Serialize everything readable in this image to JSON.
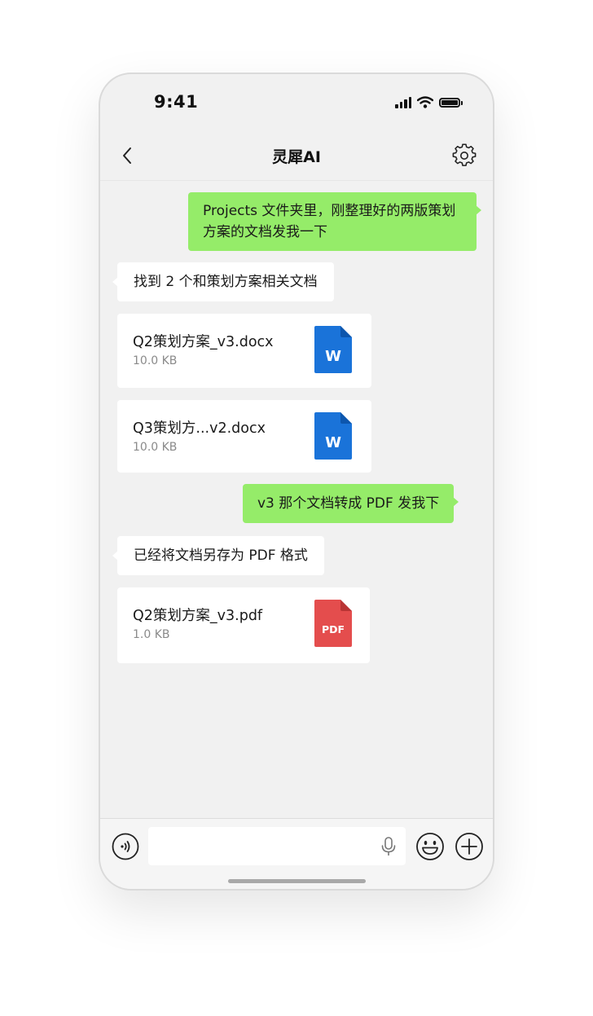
{
  "status_bar": {
    "time": "9:41"
  },
  "nav": {
    "title": "灵犀AI"
  },
  "messages": [
    {
      "role": "user",
      "text": "Projects 文件夹里，刚整理好的两版策划方案的文档发我一下"
    },
    {
      "role": "ai",
      "text": "找到 2 个和策划方案相关文档"
    },
    {
      "role": "file",
      "name": "Q2策划方案_v3.docx",
      "size": "10.0 KB",
      "icon_label": "W",
      "icon": "word-doc-icon",
      "color": "#1a73d9"
    },
    {
      "role": "file",
      "name": "Q3策划方...v2.docx",
      "size": "10.0 KB",
      "icon_label": "W",
      "icon": "word-doc-icon",
      "color": "#1a73d9"
    },
    {
      "role": "user",
      "text": "v3 那个文档转成 PDF 发我下"
    },
    {
      "role": "ai",
      "text": "已经将文档另存为 PDF 格式"
    },
    {
      "role": "file",
      "name": "Q2策划方案_v3.pdf",
      "size": "1.0 KB",
      "icon_label": "PDF",
      "icon": "pdf-doc-icon",
      "color": "#e44d4d"
    }
  ],
  "input": {
    "value": "",
    "placeholder": ""
  },
  "colors": {
    "user_bubble": "#95ec69",
    "background": "#f1f1f1",
    "word": "#1a73d9",
    "pdf": "#e44d4d"
  }
}
